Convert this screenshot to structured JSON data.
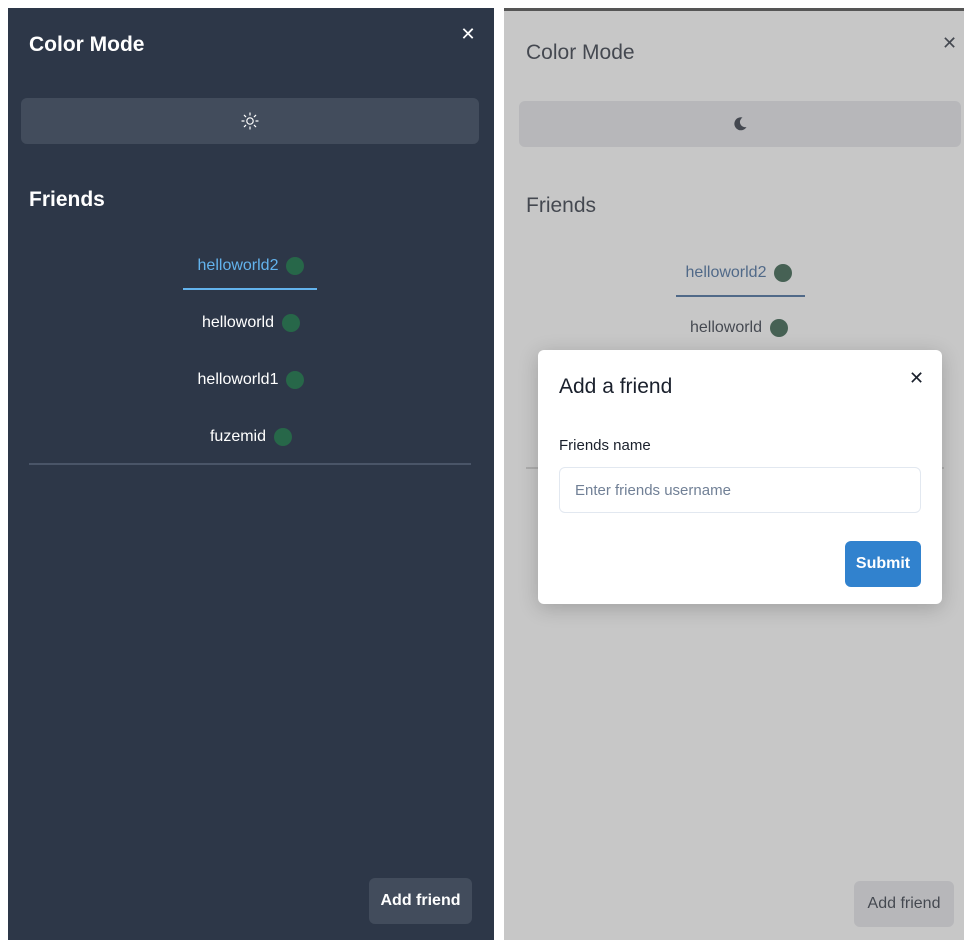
{
  "left": {
    "title": "Color Mode",
    "close_glyph": "✕",
    "mode_icon": "sun-icon",
    "mode_glyph": "☼",
    "section": "Friends",
    "friends": [
      {
        "name": "helloworld2",
        "active": true
      },
      {
        "name": "helloworld",
        "active": false
      },
      {
        "name": "helloworld1",
        "active": false
      },
      {
        "name": "fuzemid",
        "active": false
      }
    ],
    "add_label": "Add friend"
  },
  "right": {
    "title": "Color Mode",
    "close_glyph": "✕",
    "mode_icon": "moon-icon",
    "section": "Friends",
    "friends": [
      {
        "name": "helloworld2",
        "active": true
      },
      {
        "name": "helloworld",
        "active": false
      }
    ],
    "add_label": "Add friend"
  },
  "modal": {
    "title": "Add a friend",
    "close_glyph": "✕",
    "field_label": "Friends name",
    "placeholder": "Enter friends username",
    "value": "",
    "submit_label": "Submit"
  },
  "colors": {
    "dark_bg": "#2d3748",
    "accent_blue": "#63b3ed",
    "online_green": "#276749",
    "submit_blue": "#3182ce"
  }
}
